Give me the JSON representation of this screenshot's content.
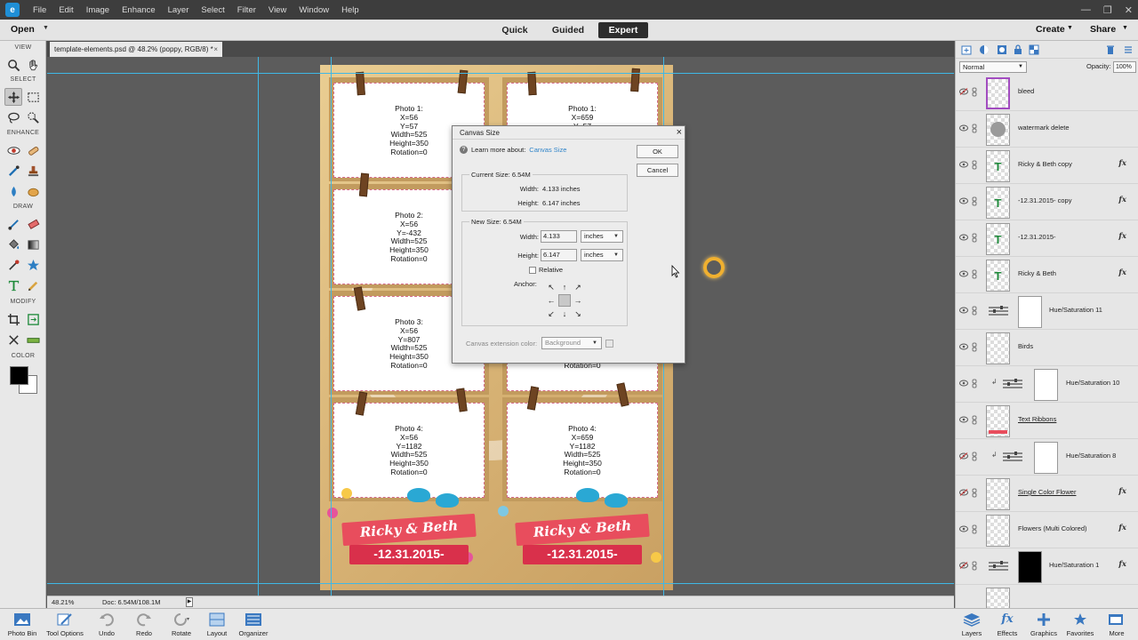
{
  "menubar": {
    "items": [
      "File",
      "Edit",
      "Image",
      "Enhance",
      "Layer",
      "Select",
      "Filter",
      "View",
      "Window",
      "Help"
    ]
  },
  "modebar": {
    "open": "Open",
    "tabs": [
      "Quick",
      "Guided",
      "Expert"
    ],
    "active_tab": "Expert",
    "create": "Create",
    "share": "Share"
  },
  "toolbox": {
    "sections": [
      "VIEW",
      "SELECT",
      "ENHANCE",
      "DRAW",
      "MODIFY",
      "COLOR"
    ]
  },
  "document": {
    "tab_title": "template-elements.psd @ 48.2% (poppy, RGB/8) *",
    "close": "×"
  },
  "poster": {
    "slots": [
      {
        "lines": [
          "Photo 1:",
          "X=56",
          "Y=57",
          "Width=525",
          "Height=350",
          "Rotation=0"
        ]
      },
      {
        "lines": [
          "Photo 1:",
          "X=659",
          "Y=57",
          "",
          "",
          ""
        ]
      },
      {
        "lines": [
          "Photo 2:",
          "X=56",
          "Y=-432",
          "Width=525",
          "Height=350",
          "Rotation=0"
        ]
      },
      {
        "lines": [
          "",
          "",
          "",
          "",
          "",
          ""
        ]
      },
      {
        "lines": [
          "Photo 3:",
          "X=56",
          "Y=807",
          "Width=525",
          "Height=350",
          "Rotation=0"
        ]
      },
      {
        "lines": [
          "",
          "",
          "",
          "",
          "",
          "Rotation=0"
        ]
      },
      {
        "lines": [
          "Photo 4:",
          "X=56",
          "Y=1182",
          "Width=525",
          "Height=350",
          "Rotation=0"
        ]
      },
      {
        "lines": [
          "Photo 4:",
          "X=659",
          "Y=1182",
          "Width=525",
          "Height=350",
          "Rotation=0"
        ]
      }
    ],
    "names": "Ricky & Beth",
    "date": "-12.31.2015-"
  },
  "dialog": {
    "title": "Canvas Size",
    "close": "×",
    "help_text": "Learn more about:",
    "help_link": "Canvas Size",
    "ok": "OK",
    "cancel": "Cancel",
    "current_size_label": "Current Size: 6.54M",
    "current_width_label": "Width:",
    "current_width": "4.133 inches",
    "current_height_label": "Height:",
    "current_height": "6.147 inches",
    "new_size_label": "New Size: 6.54M",
    "width_label": "Width:",
    "width_value": "4.133",
    "width_unit": "inches",
    "height_label": "Height:",
    "height_value": "6.147",
    "height_unit": "inches",
    "relative_label": "Relative",
    "relative_checked": false,
    "anchor_label": "Anchor:",
    "extension_label": "Canvas extension color:",
    "extension_value": "Background"
  },
  "layers_panel": {
    "blend_mode": "Normal",
    "opacity_label": "Opacity:",
    "opacity_value": "100%",
    "layers": [
      {
        "name": "bleed",
        "type": "pixel",
        "visible": false,
        "selected": true,
        "fx": false
      },
      {
        "name": "watermark delete",
        "type": "pixel",
        "visible": true,
        "fx": false
      },
      {
        "name": "Ricky & Beth copy",
        "type": "text",
        "visible": true,
        "fx": true
      },
      {
        "name": "-12.31.2015- copy",
        "type": "text",
        "visible": true,
        "fx": true
      },
      {
        "name": "-12.31.2015-",
        "type": "text",
        "visible": true,
        "fx": true
      },
      {
        "name": "Ricky & Beth",
        "type": "text",
        "visible": true,
        "fx": true
      },
      {
        "name": "Hue/Saturation 11",
        "type": "adjustment",
        "visible": true,
        "fx": false,
        "mask": "white"
      },
      {
        "name": "Birds",
        "type": "pixel",
        "visible": true,
        "fx": false
      },
      {
        "name": "Hue/Saturation 10",
        "type": "adjustment",
        "visible": true,
        "fx": false,
        "mask": "white",
        "clipped": true
      },
      {
        "name": "Text Ribbons",
        "type": "pixel",
        "visible": true,
        "fx": false,
        "underline": true
      },
      {
        "name": "Hue/Saturation 8",
        "type": "adjustment",
        "visible": false,
        "fx": false,
        "mask": "white",
        "clipped": true
      },
      {
        "name": "Single Color Flower",
        "type": "pixel",
        "visible": false,
        "fx": true,
        "underline": true
      },
      {
        "name": "Flowers (Multi Colored)",
        "type": "pixel",
        "visible": true,
        "fx": true
      },
      {
        "name": "Hue/Saturation 1",
        "type": "adjustment",
        "visible": false,
        "fx": true,
        "mask": "black"
      }
    ]
  },
  "statusbar": {
    "zoom": "48.21%",
    "doc": "Doc: 6.54M/108.1M"
  },
  "taskbar": {
    "left": [
      "Photo Bin",
      "Tool Options",
      "Undo",
      "Redo",
      "Rotate",
      "Layout",
      "Organizer"
    ],
    "right": [
      "Layers",
      "Effects",
      "Graphics",
      "Favorites",
      "More"
    ]
  },
  "colors": {
    "accent_blue": "#2f84c9",
    "guide_cyan": "#3fb8e6",
    "ribbon_red": "#e84d5d",
    "selected_layer_border": "#a24cc0"
  }
}
